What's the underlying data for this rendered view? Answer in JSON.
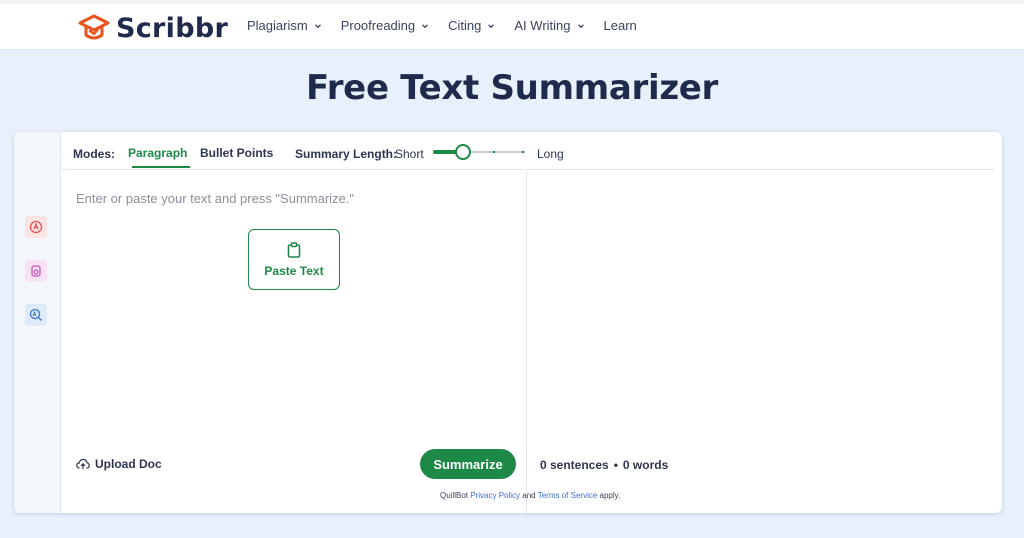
{
  "header": {
    "logo_text": "Scribbr",
    "brand_color": "#e8531f",
    "nav": [
      {
        "label": "Plagiarism",
        "has_dropdown": true
      },
      {
        "label": "Proofreading",
        "has_dropdown": true
      },
      {
        "label": "Citing",
        "has_dropdown": true
      },
      {
        "label": "AI Writing",
        "has_dropdown": true
      },
      {
        "label": "Learn",
        "has_dropdown": false
      }
    ]
  },
  "page": {
    "title": "Free Text Summarizer"
  },
  "sidebar": {
    "tools": [
      {
        "icon": "paraphrase-icon",
        "color": "#f4d8d8"
      },
      {
        "icon": "grammar-icon",
        "color": "#f3dcf2"
      },
      {
        "icon": "ai-detector-icon",
        "color": "#dbe9f9"
      }
    ]
  },
  "modes": {
    "label": "Modes:",
    "tabs": [
      {
        "label": "Paragraph",
        "active": true
      },
      {
        "label": "Bullet Points",
        "active": false
      }
    ],
    "summary_length": {
      "label": "Summary Length:",
      "min_label": "Short",
      "max_label": "Long",
      "value_fraction": 0.33
    }
  },
  "input": {
    "placeholder": "Enter or paste your text and press \"Summarize.\"",
    "paste_label": "Paste Text",
    "upload_label": "Upload Doc",
    "summarize_label": "Summarize"
  },
  "output": {
    "sentences": "0 sentences",
    "separator": "•",
    "words": "0 words"
  },
  "footer": {
    "prefix": "QuillBot",
    "privacy": "Privacy Policy",
    "and": "and",
    "terms": "Terms of Service",
    "suffix": "apply."
  },
  "colors": {
    "accent_green": "#1c8a46",
    "title_navy": "#1f2a4d",
    "page_background": "#e8f1fb"
  }
}
